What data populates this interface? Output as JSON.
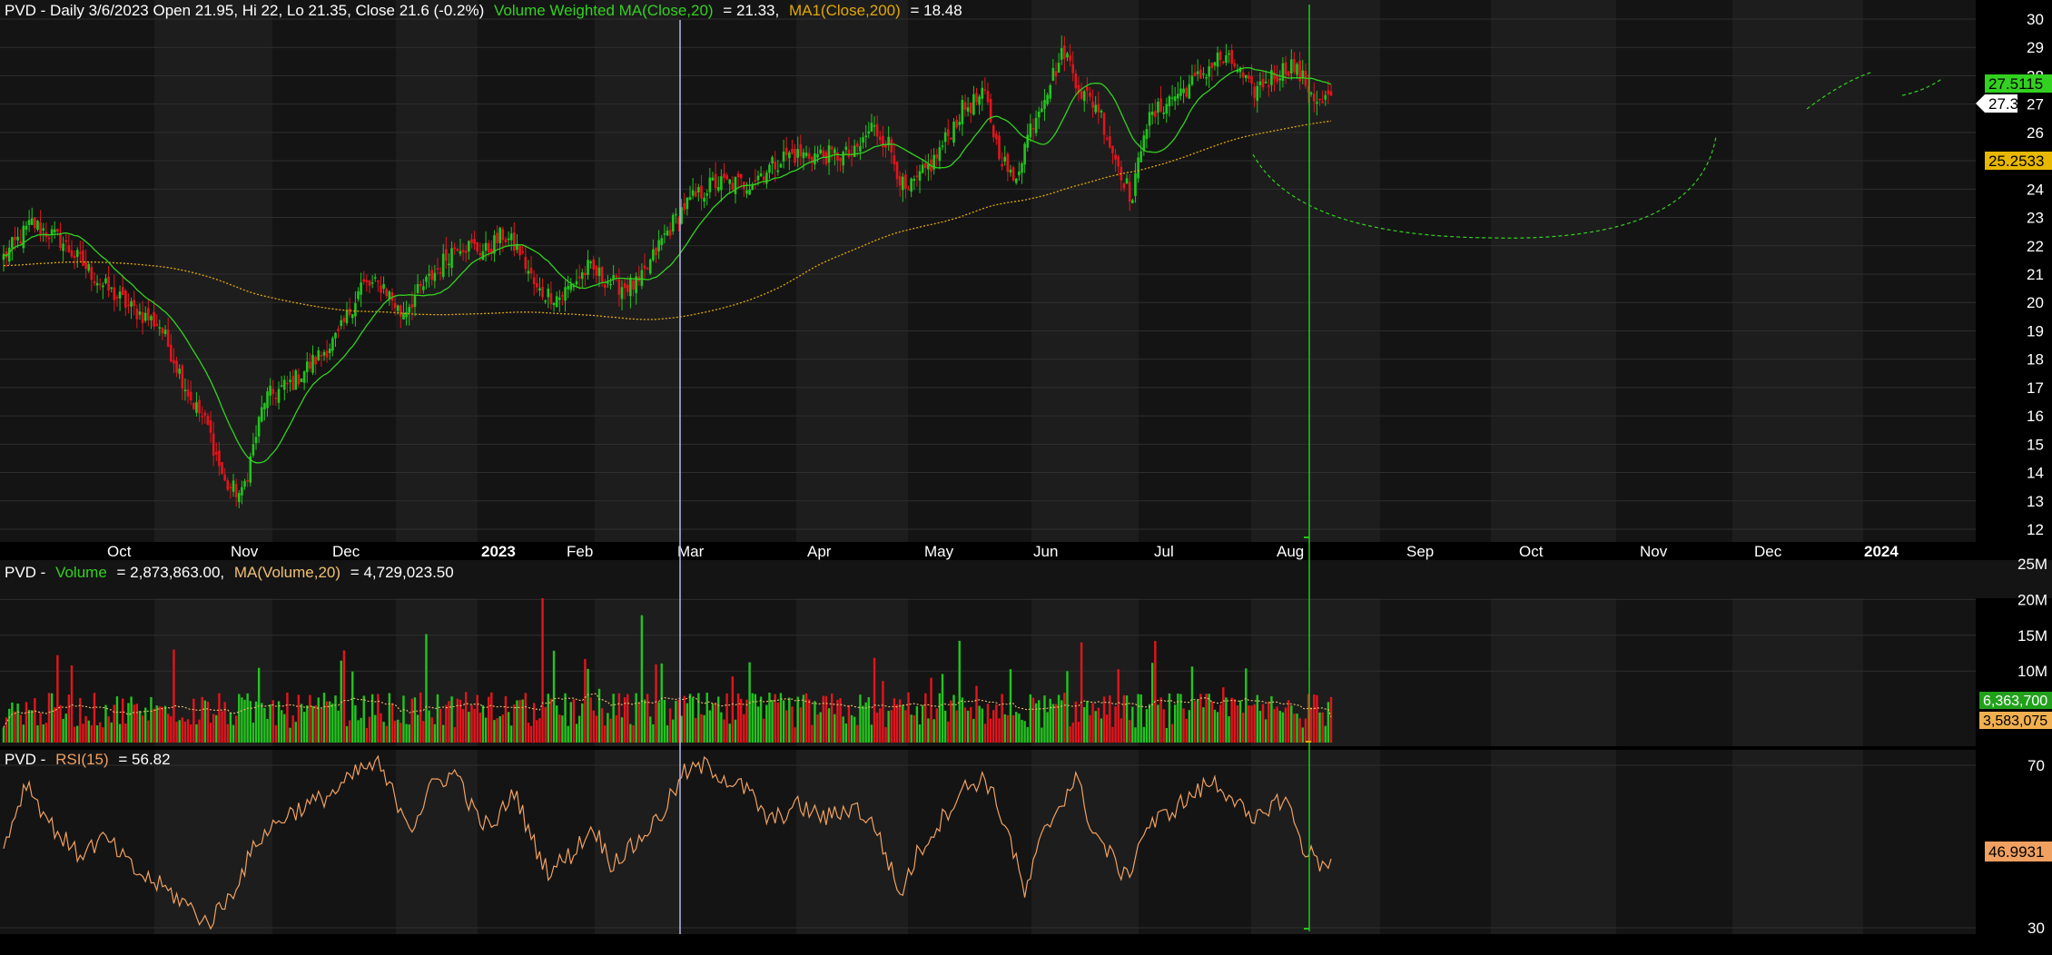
{
  "colors": {
    "background": "#000000",
    "panel_dark": "#141414",
    "panel_light": "#1d1d1d",
    "grid": "#2e2e2e",
    "axis_text": "#ffffff",
    "up": "#22c51e",
    "down": "#e4141c",
    "vwma": "#33d11f",
    "ma200": "#e0a800",
    "vol_ma": "#f0c070",
    "rsi": "#f0a060",
    "cursor": "#b8b8e8",
    "marker": "#22c51e"
  },
  "header": {
    "price": {
      "prefix": "PVD - Daily 3/6/2023 Open 21.95, Hi 22, Lo 21.35, Close 21.6 (-0.2%)",
      "vwma_label": "Volume Weighted MA(Close,20)",
      "vwma_value": "= 21.33,",
      "ma_label": "MA1(Close,200)",
      "ma_value": "= 18.48"
    },
    "volume": {
      "prefix": "PVD -",
      "vol_label": "Volume",
      "vol_value": "= 2,873,863.00,",
      "ma_label": "MA(Volume,20)",
      "ma_value": "= 4,729,023.50"
    },
    "rsi": {
      "prefix": "PVD -",
      "label": "RSI(15)",
      "value": "= 56.82"
    }
  },
  "badges": {
    "vwma": "27.5115",
    "close": "27.3",
    "ma200": "25.2533",
    "volume": "6,363,700",
    "volume_ma": "3,583,075",
    "rsi": "46.9931"
  },
  "price_axis": {
    "ticks": [
      "12",
      "13",
      "14",
      "15",
      "16",
      "17",
      "18",
      "19",
      "20",
      "21",
      "22",
      "23",
      "24",
      "25",
      "26",
      "27",
      "28",
      "29",
      "30"
    ]
  },
  "volume_axis": {
    "ticks": [
      "10M",
      "15M",
      "20M",
      "25M"
    ]
  },
  "rsi_axis": {
    "ticks": [
      "30",
      "70"
    ]
  },
  "months": [
    "Oct",
    "Nov",
    "Dec",
    "2023",
    "Feb",
    "Mar",
    "Apr",
    "May",
    "Jun",
    "Jul",
    "Aug",
    "Sep",
    "Oct",
    "Nov",
    "Dec",
    "2024"
  ],
  "chart_data": {
    "type": "candlestick",
    "ticker": "PVD",
    "interval": "Daily",
    "x_range": [
      "2022-09",
      "2024-01"
    ],
    "ylim": [
      12,
      30
    ],
    "series": [
      {
        "name": "Volume Weighted MA(Close,20)",
        "last": 27.5115
      },
      {
        "name": "MA1(Close,200)",
        "last": 25.2533
      }
    ],
    "last_close": 27.3,
    "close_path": [
      [
        0,
        21.6
      ],
      [
        10,
        22.8
      ],
      [
        20,
        22.2
      ],
      [
        35,
        20.6
      ],
      [
        45,
        19.8
      ],
      [
        55,
        19.2
      ],
      [
        66,
        16.6
      ],
      [
        72,
        15.6
      ],
      [
        78,
        13.6
      ],
      [
        84,
        13.2
      ],
      [
        92,
        16.6
      ],
      [
        102,
        17.2
      ],
      [
        110,
        18.0
      ],
      [
        118,
        18.8
      ],
      [
        126,
        20.6
      ],
      [
        134,
        20.6
      ],
      [
        140,
        19.6
      ],
      [
        150,
        20.8
      ],
      [
        160,
        22.1
      ],
      [
        170,
        21.8
      ],
      [
        176,
        22.4
      ],
      [
        182,
        21.8
      ],
      [
        188,
        20.4
      ],
      [
        196,
        20.2
      ],
      [
        206,
        21.2
      ],
      [
        216,
        20.6
      ],
      [
        224,
        20.6
      ],
      [
        232,
        22.2
      ],
      [
        240,
        23.4
      ],
      [
        250,
        24.2
      ],
      [
        262,
        24.2
      ],
      [
        276,
        25.2
      ],
      [
        290,
        25.2
      ],
      [
        300,
        25.2
      ],
      [
        306,
        26.2
      ],
      [
        312,
        25.6
      ],
      [
        318,
        23.8
      ],
      [
        328,
        25.0
      ],
      [
        338,
        26.8
      ],
      [
        346,
        27.3
      ],
      [
        350,
        25.6
      ],
      [
        356,
        24.2
      ],
      [
        362,
        26.2
      ],
      [
        368,
        27.6
      ],
      [
        374,
        28.9
      ],
      [
        380,
        27.4
      ],
      [
        386,
        26.9
      ],
      [
        390,
        25.6
      ],
      [
        394,
        24.6
      ],
      [
        398,
        23.6
      ],
      [
        402,
        26.2
      ],
      [
        410,
        27.1
      ],
      [
        420,
        27.8
      ],
      [
        428,
        28.6
      ],
      [
        434,
        28.4
      ],
      [
        440,
        27.4
      ],
      [
        446,
        27.9
      ],
      [
        454,
        28.4
      ],
      [
        460,
        27.6
      ],
      [
        464,
        27.0
      ],
      [
        468,
        27.3
      ]
    ],
    "volume": {
      "ylim": [
        0,
        25000000
      ],
      "last": 6363700,
      "ma20_last": 3583075
    },
    "rsi": {
      "period": 15,
      "ylim": [
        25,
        75
      ],
      "last": 46.9931,
      "path": [
        [
          0,
          50
        ],
        [
          8,
          66
        ],
        [
          16,
          56
        ],
        [
          26,
          48
        ],
        [
          36,
          52
        ],
        [
          46,
          44
        ],
        [
          56,
          40
        ],
        [
          64,
          36
        ],
        [
          72,
          31
        ],
        [
          80,
          38
        ],
        [
          90,
          52
        ],
        [
          100,
          58
        ],
        [
          110,
          61
        ],
        [
          118,
          64
        ],
        [
          126,
          69
        ],
        [
          132,
          70
        ],
        [
          138,
          62
        ],
        [
          144,
          55
        ],
        [
          152,
          66
        ],
        [
          160,
          68
        ],
        [
          166,
          58
        ],
        [
          172,
          54
        ],
        [
          180,
          64
        ],
        [
          186,
          52
        ],
        [
          192,
          44
        ],
        [
          200,
          48
        ],
        [
          208,
          55
        ],
        [
          214,
          46
        ],
        [
          222,
          50
        ],
        [
          232,
          58
        ],
        [
          240,
          68
        ],
        [
          248,
          70
        ],
        [
          256,
          66
        ],
        [
          262,
          64
        ],
        [
          270,
          56
        ],
        [
          280,
          60
        ],
        [
          290,
          57
        ],
        [
          300,
          60
        ],
        [
          308,
          54
        ],
        [
          316,
          38
        ],
        [
          322,
          48
        ],
        [
          330,
          56
        ],
        [
          338,
          64
        ],
        [
          346,
          67
        ],
        [
          354,
          54
        ],
        [
          360,
          38
        ],
        [
          366,
          52
        ],
        [
          372,
          60
        ],
        [
          378,
          67
        ],
        [
          384,
          54
        ],
        [
          390,
          48
        ],
        [
          396,
          42
        ],
        [
          402,
          54
        ],
        [
          410,
          58
        ],
        [
          418,
          62
        ],
        [
          426,
          66
        ],
        [
          434,
          62
        ],
        [
          440,
          55
        ],
        [
          446,
          60
        ],
        [
          452,
          62
        ],
        [
          458,
          50
        ],
        [
          464,
          46
        ],
        [
          468,
          47
        ]
      ]
    }
  }
}
